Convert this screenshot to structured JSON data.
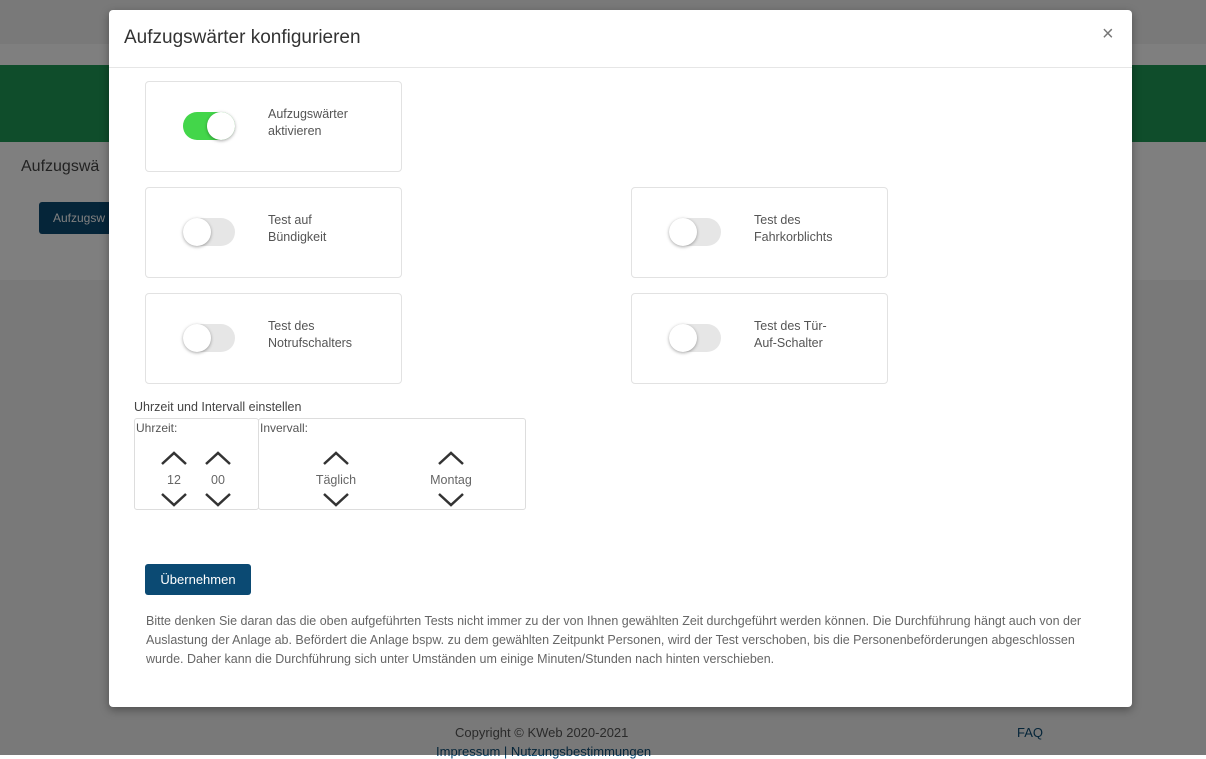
{
  "background": {
    "section_title": "Aufzugswä",
    "button_label": "Aufzugsw",
    "footer": {
      "copyright": "Copyright © KWeb 2020-2021",
      "links": "Impressum | Nutzungsbestimmungen",
      "faq": "FAQ"
    }
  },
  "modal": {
    "title": "Aufzugswärter konfigurieren",
    "close_symbol": "×",
    "toggles": [
      {
        "label_line1": "Aufzugswärter",
        "label_line2": "aktivieren",
        "enabled": true
      },
      {
        "label_line1": "Test auf",
        "label_line2": "Bündigkeit",
        "enabled": false
      },
      {
        "label_line1": "Test des",
        "label_line2": "Fahrkorblichts",
        "enabled": false
      },
      {
        "label_line1": "Test des",
        "label_line2": "Notrufschalters",
        "enabled": false
      },
      {
        "label_line1": "Test des Tür-",
        "label_line2": "Auf-Schalter",
        "enabled": false
      }
    ],
    "schedule": {
      "section_label": "Uhrzeit und Intervall einstellen",
      "time_label": "Uhrzeit:",
      "hour": "12",
      "minute": "00",
      "interval_label": "Invervall:",
      "interval": "Täglich",
      "day": "Montag"
    },
    "apply_label": "Übernehmen",
    "note": "Bitte denken Sie daran das die oben aufgeführten Tests nicht immer zu der von Ihnen gewählten Zeit durchgeführt werden können. Die Durchführung hängt auch von der Auslastung der Anlage ab. Befördert die Anlage bspw. zu dem gewählten Zeitpunkt Personen, wird der Test verschoben, bis die Personenbeförderungen abgeschlossen wurde. Daher kann die Durchführung sich unter Umständen um einige Minuten/Stunden nach hinten verschieben."
  },
  "colors": {
    "accent_green": "#1e9a57",
    "toggle_on": "#43d64a",
    "button_blue": "#0b4a73"
  },
  "icons": [
    "close-icon",
    "chevron-up-icon",
    "chevron-down-icon"
  ]
}
